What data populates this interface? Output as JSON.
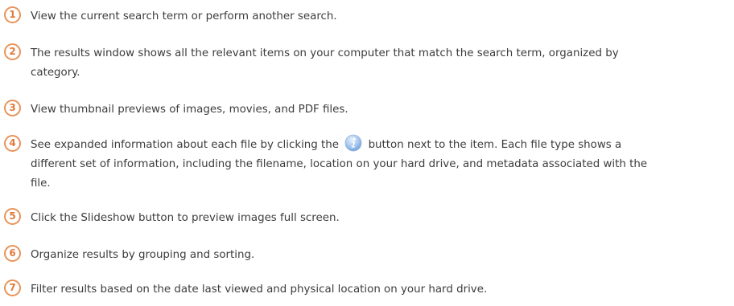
{
  "steps": [
    {
      "number": "1",
      "text": "View the current search term or perform another search."
    },
    {
      "number": "2",
      "text": "The results window shows all the relevant items on your computer that match the search term, organized by category."
    },
    {
      "number": "3",
      "text": "View thumbnail previews of images, movies, and PDF files."
    },
    {
      "number": "4",
      "text_before": "See expanded information about each file by clicking the",
      "icon": "info-button-icon",
      "text_after": "button next to the item. Each file type shows a different set of information, including the filename, location on your hard drive, and metadata associated with the file."
    },
    {
      "number": "5",
      "text": "Click the Slideshow button to preview images full screen."
    },
    {
      "number": "6",
      "text": "Organize results by grouping and sorting."
    },
    {
      "number": "7",
      "text": "Filter results based on the date last viewed and physical location on your hard drive."
    }
  ],
  "colors": {
    "badge_border": "#e8945a",
    "badge_text": "#e07a3c",
    "body_text": "#3c3c3c",
    "info_icon": "#6f9fd8"
  }
}
